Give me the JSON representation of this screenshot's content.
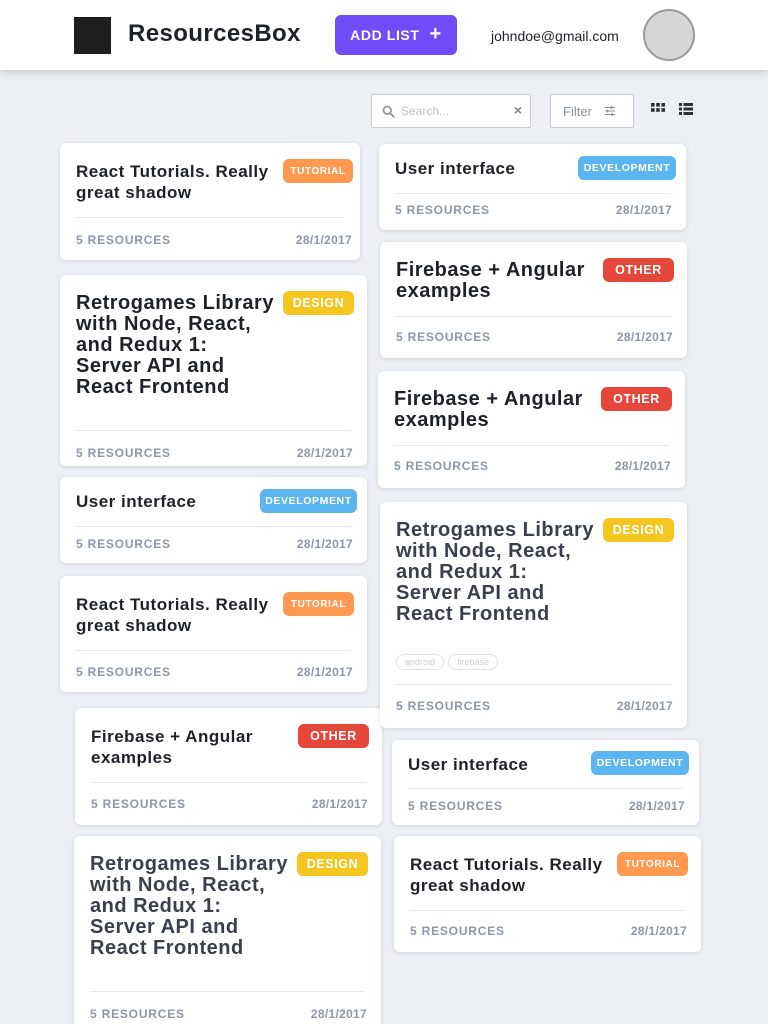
{
  "header": {
    "app_title": "ResourcesBox",
    "add_list_label": "ADD LIST",
    "add_list_icon": "+",
    "user_email": "johndoe@gmail.com"
  },
  "toolbar": {
    "search_placeholder": "Search...",
    "search_value": "",
    "clear_icon": "×",
    "filter_label": "Filter"
  },
  "colors": {
    "accent": "#6f4cf5",
    "tutorial": "#fd9a50",
    "design": "#f5c520",
    "development": "#5bb5f0",
    "other": "#e5483a"
  },
  "cards": [
    {
      "title": "React Tutorials. Really great shadow",
      "badge": "TUTORIAL",
      "count": "5 RESOURCES",
      "date": "28/1/2017"
    },
    {
      "title": "Retrogames Library with Node, React, and Redux 1: Server API and React Frontend",
      "badge": "DESIGN",
      "count": "5 RESOURCES",
      "date": "28/1/2017"
    },
    {
      "title": "User interface",
      "badge": "DEVELOPMENT",
      "count": "5 RESOURCES",
      "date": "28/1/2017"
    },
    {
      "title": "React Tutorials. Really great shadow",
      "badge": "TUTORIAL",
      "count": "5 RESOURCES",
      "date": "28/1/2017"
    },
    {
      "title": "Firebase + Angular examples",
      "badge": "OTHER",
      "count": "5 RESOURCES",
      "date": "28/1/2017"
    },
    {
      "title": "Retrogames Library with Node, React, and Redux 1: Server API and React Frontend",
      "badge": "DESIGN",
      "count": "5 RESOURCES",
      "date": "28/1/2017"
    },
    {
      "title": "User interface",
      "badge": "DEVELOPMENT",
      "count": "5 RESOURCES",
      "date": "28/1/2017"
    },
    {
      "title": "Firebase + Angular examples",
      "badge": "OTHER",
      "count": "5 RESOURCES",
      "date": "28/1/2017"
    },
    {
      "title": "Firebase + Angular examples",
      "badge": "OTHER",
      "count": "5 RESOURCES",
      "date": "28/1/2017"
    },
    {
      "title": "Retrogames Library with Node, React, and Redux 1: Server API and React Frontend",
      "badge": "DESIGN",
      "count": "5 RESOURCES",
      "date": "28/1/2017",
      "tags": [
        "android",
        "firebase"
      ]
    },
    {
      "title": "User interface",
      "badge": "DEVELOPMENT",
      "count": "5 RESOURCES",
      "date": "28/1/2017"
    },
    {
      "title": "React Tutorials. Really great shadow",
      "badge": "TUTORIAL",
      "count": "5 RESOURCES",
      "date": "28/1/2017"
    }
  ]
}
